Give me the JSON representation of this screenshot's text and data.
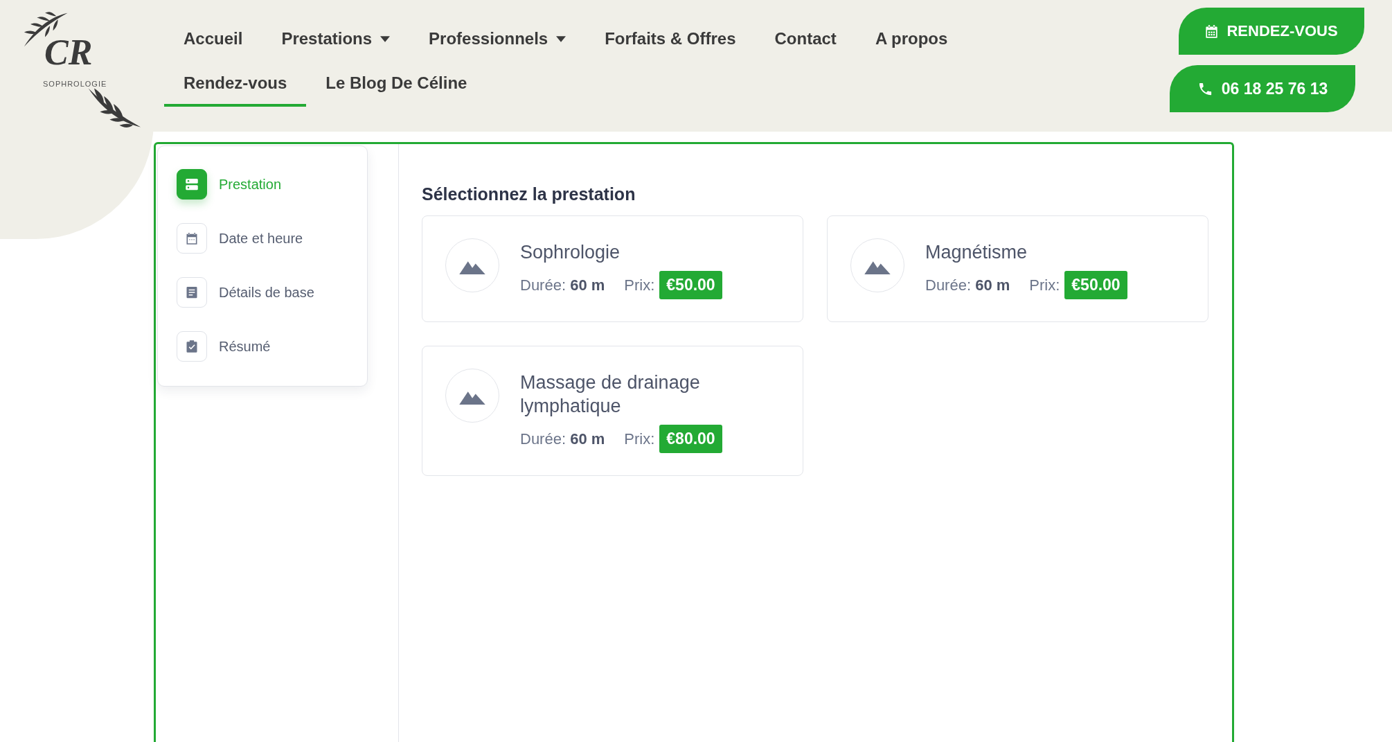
{
  "logo": {
    "initials": "CR",
    "subtitle": "SOPHROLOGIE"
  },
  "nav": [
    {
      "label": "Accueil",
      "dropdown": false,
      "selected": false
    },
    {
      "label": "Prestations",
      "dropdown": true,
      "selected": false
    },
    {
      "label": "Professionnels",
      "dropdown": true,
      "selected": false
    },
    {
      "label": "Forfaits & Offres",
      "dropdown": false,
      "selected": false
    },
    {
      "label": "Contact",
      "dropdown": false,
      "selected": false
    },
    {
      "label": "A propos",
      "dropdown": false,
      "selected": false
    },
    {
      "label": "Rendez-vous",
      "dropdown": false,
      "selected": true
    },
    {
      "label": "Le Blog De Céline",
      "dropdown": false,
      "selected": false
    }
  ],
  "header_buttons": [
    {
      "kind": "calendar",
      "label": "RENDEZ-VOUS"
    },
    {
      "kind": "phone",
      "label": "06 18 25 76 13"
    }
  ],
  "steps": [
    {
      "kind": "service",
      "label": "Prestation",
      "selected": true
    },
    {
      "kind": "calendar",
      "label": "Date et heure",
      "selected": false
    },
    {
      "kind": "details",
      "label": "Détails de base",
      "selected": false
    },
    {
      "kind": "summary",
      "label": "Résumé",
      "selected": false
    }
  ],
  "panel": {
    "title": "Sélectionnez la prestation",
    "services": [
      {
        "name": "Sophrologie",
        "duration_label": "Durée:",
        "duration": "60 m",
        "price_label": "Prix:",
        "price": "€50.00"
      },
      {
        "name": "Magnétisme",
        "duration_label": "Durée:",
        "duration": "60 m",
        "price_label": "Prix:",
        "price": "€50.00"
      },
      {
        "name": "Massage de drainage lymphatique",
        "duration_label": "Durée:",
        "duration": "60 m",
        "price_label": "Prix:",
        "price": "€80.00"
      }
    ]
  }
}
